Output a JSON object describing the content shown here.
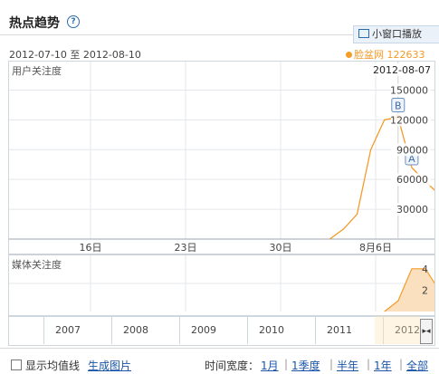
{
  "header": {
    "title": "热点趋势",
    "help_icon": "?"
  },
  "range": {
    "text": "2012-07-10 至 2012-08-10"
  },
  "small_window": {
    "label": "小窗口播放"
  },
  "legend": {
    "name": "脸盆网",
    "value": "122633"
  },
  "user_panel": {
    "label": "用户关注度",
    "date_label": "2012-08-07",
    "y_ticks": [
      "150000",
      "120000",
      "90000",
      "60000",
      "30000"
    ],
    "x_ticks": [
      "16日",
      "23日",
      "30日",
      "8月6日"
    ],
    "markers": [
      "A",
      "B"
    ]
  },
  "media_panel": {
    "label": "媒体关注度",
    "y_ticks": [
      "4",
      "2"
    ]
  },
  "timeline": {
    "years": [
      "2007",
      "2008",
      "2009",
      "2010",
      "2011",
      "2012"
    ],
    "scroll_icon": "▸◂"
  },
  "footer": {
    "show_avg": "显示均值线",
    "make_image": "生成图片",
    "time_width_label": "时间宽度：",
    "options": [
      "1月",
      "1季度",
      "半年",
      "1年",
      "全部"
    ]
  },
  "colors": {
    "series": "#f49b28",
    "grid": "#e3e7eb",
    "link": "#1a55a8"
  },
  "chart_data": [
    {
      "type": "line",
      "title": "",
      "ylabel": "用户关注度",
      "x_ticks": [
        "16日",
        "23日",
        "30日",
        "8月6日"
      ],
      "ylim": [
        0,
        165000
      ],
      "series": [
        {
          "name": "脸盆网",
          "x": [
            "2012-08-02",
            "2012-08-03",
            "2012-08-04",
            "2012-08-05",
            "2012-08-06",
            "2012-08-07",
            "2012-08-08",
            "2012-08-09",
            "2012-08-10"
          ],
          "values": [
            0,
            10000,
            25000,
            90000,
            120000,
            122633,
            72000,
            58000,
            45000
          ]
        }
      ],
      "annotations": [
        "A",
        "B"
      ],
      "grid": true
    },
    {
      "type": "area",
      "ylabel": "媒体关注度",
      "ylim": [
        0,
        5
      ],
      "series": [
        {
          "name": "脸盆网",
          "x": [
            "2012-08-06",
            "2012-08-07",
            "2012-08-08",
            "2012-08-09",
            "2012-08-10"
          ],
          "values": [
            0,
            1,
            4,
            4,
            2
          ]
        }
      ]
    }
  ]
}
